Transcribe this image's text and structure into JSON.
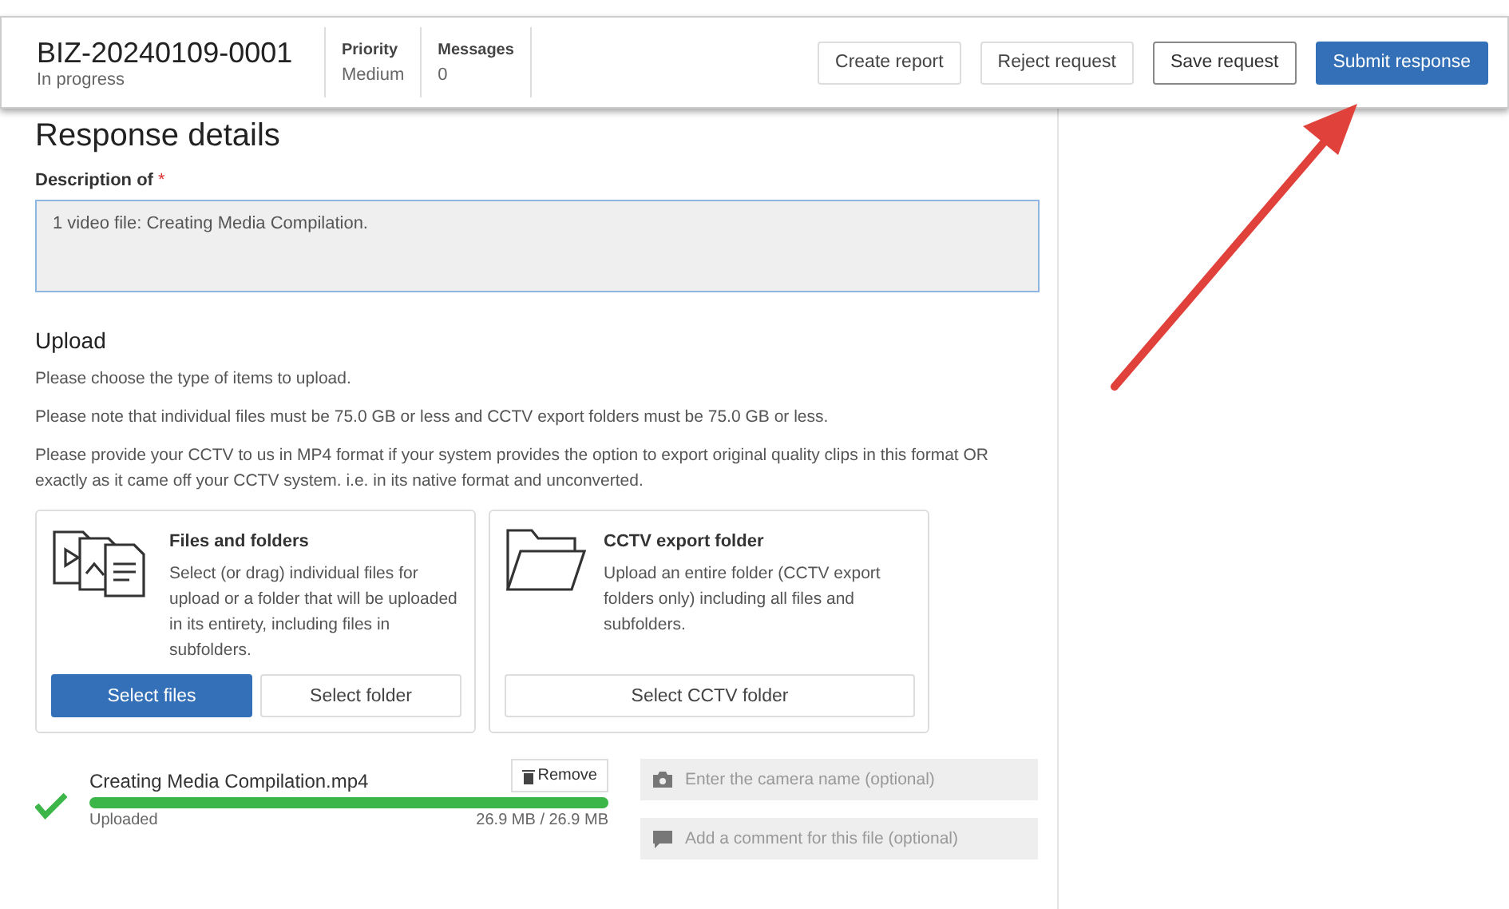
{
  "header": {
    "reference": "BIZ-20240109-0001",
    "status": "In progress",
    "meta": [
      {
        "label": "Priority",
        "value": "Medium"
      },
      {
        "label": "Messages",
        "value": "0"
      }
    ],
    "buttons": [
      {
        "label": "Create report",
        "kind": "plain"
      },
      {
        "label": "Reject request",
        "kind": "plain"
      },
      {
        "label": "Save request",
        "kind": "outlined"
      },
      {
        "label": "Submit response",
        "kind": "primary"
      }
    ]
  },
  "response": {
    "title": "Response details",
    "field_label": "Description of",
    "required_mark": "*",
    "description_value": "1 video file: Creating Media Compilation."
  },
  "upload": {
    "title": "Upload",
    "notes": [
      "Please choose the type of items to upload.",
      "Please note that individual files must be 75.0 GB or less and CCTV export folders must be 75.0 GB or less.",
      "Please provide your CCTV to us in MP4 format if your system provides the option to export original quality clips in this format OR exactly as it came off your CCTV system. i.e. in its native format and unconverted."
    ],
    "options": [
      {
        "kind": "files",
        "title": "Files and folders",
        "text": "Select (or drag) individual files for upload or a folder that will be uploaded in its entirety, including files in subfolders.",
        "buttons": [
          {
            "label": "Select files",
            "kind": "primary"
          },
          {
            "label": "Select folder",
            "kind": "plain"
          }
        ]
      },
      {
        "kind": "folder",
        "title": "CCTV export folder",
        "text": "Upload an entire folder (CCTV export folders only) including all files and subfolders.",
        "buttons": [
          {
            "label": "Select CCTV folder",
            "kind": "plain"
          }
        ]
      }
    ],
    "file": {
      "name": "Creating Media Compilation.mp4",
      "status": "Uploaded",
      "size": "26.9 MB / 26.9 MB",
      "level": 1,
      "remove": "Remove",
      "camera_placeholder": "Enter the camera name (optional)",
      "comment_placeholder": "Add a comment for this file (optional)"
    }
  }
}
